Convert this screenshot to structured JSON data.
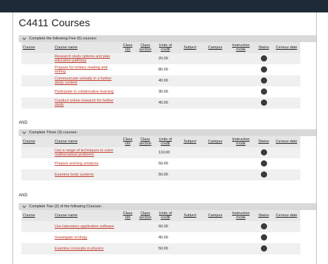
{
  "page_title": "C4411 Courses",
  "and_label": "AND",
  "columns": {
    "course": "Course",
    "course_name": "Course name",
    "class_nbr": "Class nbr",
    "class_section": "Class section",
    "units_of_credit": "Units of credit",
    "subject": "Subject",
    "campus": "Campus",
    "instruction_mode": "Instruction mode",
    "status": "Status",
    "census_date": "Census date"
  },
  "groups": [
    {
      "title": "Complete the following Five (5) courses:",
      "rows": [
        {
          "name": "Research study options and plan education pathway",
          "units": "20.00"
        },
        {
          "name": "Prepare for tertiary reading and writing",
          "units": "80.00"
        },
        {
          "name": "Communicate verbally in a further study context",
          "units": "40.00"
        },
        {
          "name": "Participate in collaborative learning",
          "units": "30.00"
        },
        {
          "name": "Conduct online research for further study",
          "units": "40.00"
        }
      ]
    },
    {
      "title": "Complete Three (3) courses:",
      "rows": [
        {
          "name": "Use a range of techniques to solve mathematical problems",
          "units": "110.00"
        },
        {
          "name": "Prepare working solutions",
          "units": "50.00"
        },
        {
          "name": "Examine body systems",
          "units": "50.00"
        }
      ]
    },
    {
      "title": "Complete Two (2) of the following Courses:",
      "rows": [
        {
          "name": "Use laboratory application software",
          "units": "60.00"
        },
        {
          "name": "Investigate ecology",
          "units": "40.00"
        },
        {
          "name": "Examine concepts in physics",
          "units": "50.00"
        }
      ]
    }
  ]
}
